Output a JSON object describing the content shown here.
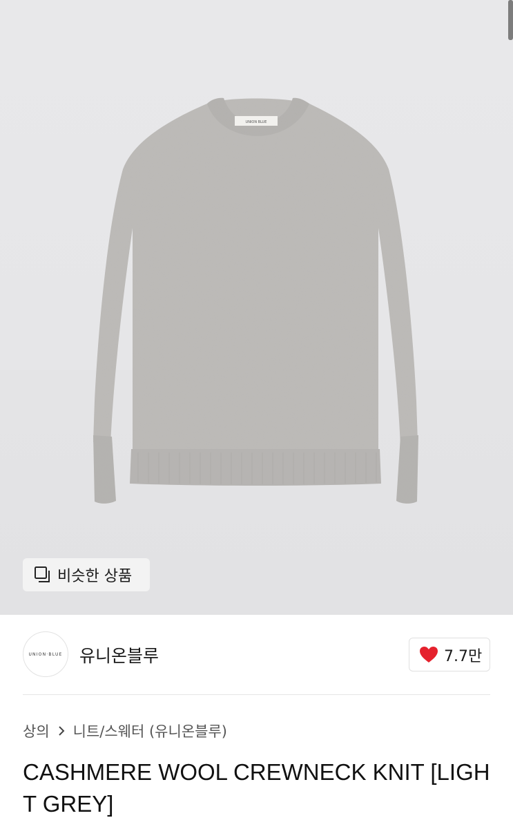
{
  "product_image": {
    "tag_text": "UNION BLUE",
    "similar_button": {
      "icon": "similar-items-icon",
      "label": "비슷한 상품"
    }
  },
  "brand": {
    "logo_text": "UNION·BLUE",
    "name": "유니온블루",
    "like": {
      "icon": "heart-icon",
      "count": "7.7만",
      "color": "#e5212d"
    }
  },
  "breadcrumb": {
    "category": "상의",
    "separator_icon": "chevron-right-icon",
    "subcategory": "니트/스웨터 (유니온블루)"
  },
  "product": {
    "title": "CASHMERE WOOL CREWNECK KNIT [LIGHT GREY]"
  }
}
